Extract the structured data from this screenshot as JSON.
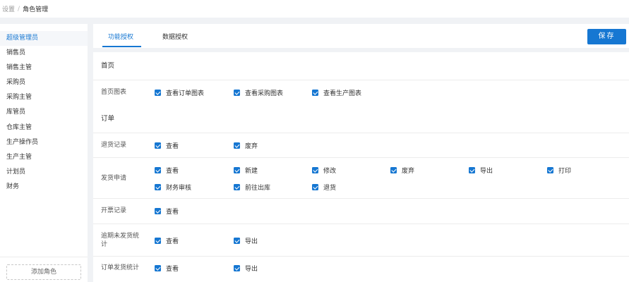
{
  "breadcrumb": {
    "parent": "设置",
    "separator": "/",
    "current": "角色管理"
  },
  "sidebar": {
    "roles": [
      "超级管理员",
      "销售员",
      "销售主管",
      "采购员",
      "采购主管",
      "库管员",
      "仓库主管",
      "生产操作员",
      "生产主管",
      "计划员",
      "财务"
    ],
    "active_index": 0,
    "add_button": "添加角色"
  },
  "tabs": {
    "function": "功能授权",
    "data": "数据授权",
    "active": "功能授权"
  },
  "toolbar": {
    "save_label": "保存"
  },
  "sections": [
    {
      "title": "首页",
      "rows": [
        {
          "label": "首页图表",
          "items": [
            [
              "查看订单图表",
              "查看采购图表",
              "查看生产图表"
            ]
          ]
        }
      ]
    },
    {
      "title": "订单",
      "rows": [
        {
          "label": "退货记录",
          "items": [
            [
              "查看",
              "废弃"
            ]
          ]
        },
        {
          "label": "发货申请",
          "items": [
            [
              "查看",
              "新建",
              "修改",
              "废弃",
              "导出",
              "打印"
            ],
            [
              "财务审核",
              "前往出库",
              "退货"
            ]
          ]
        },
        {
          "label": "开票记录",
          "items": [
            [
              "查看"
            ]
          ]
        },
        {
          "label": "逾期未发货统计",
          "items": [
            [
              "查看",
              "导出"
            ]
          ]
        },
        {
          "label": "订单发货统计",
          "items": [
            [
              "查看",
              "导出"
            ]
          ]
        }
      ]
    }
  ],
  "checked": true,
  "colors": {
    "primary": "#1677d2",
    "background": "#f0f2f5"
  }
}
